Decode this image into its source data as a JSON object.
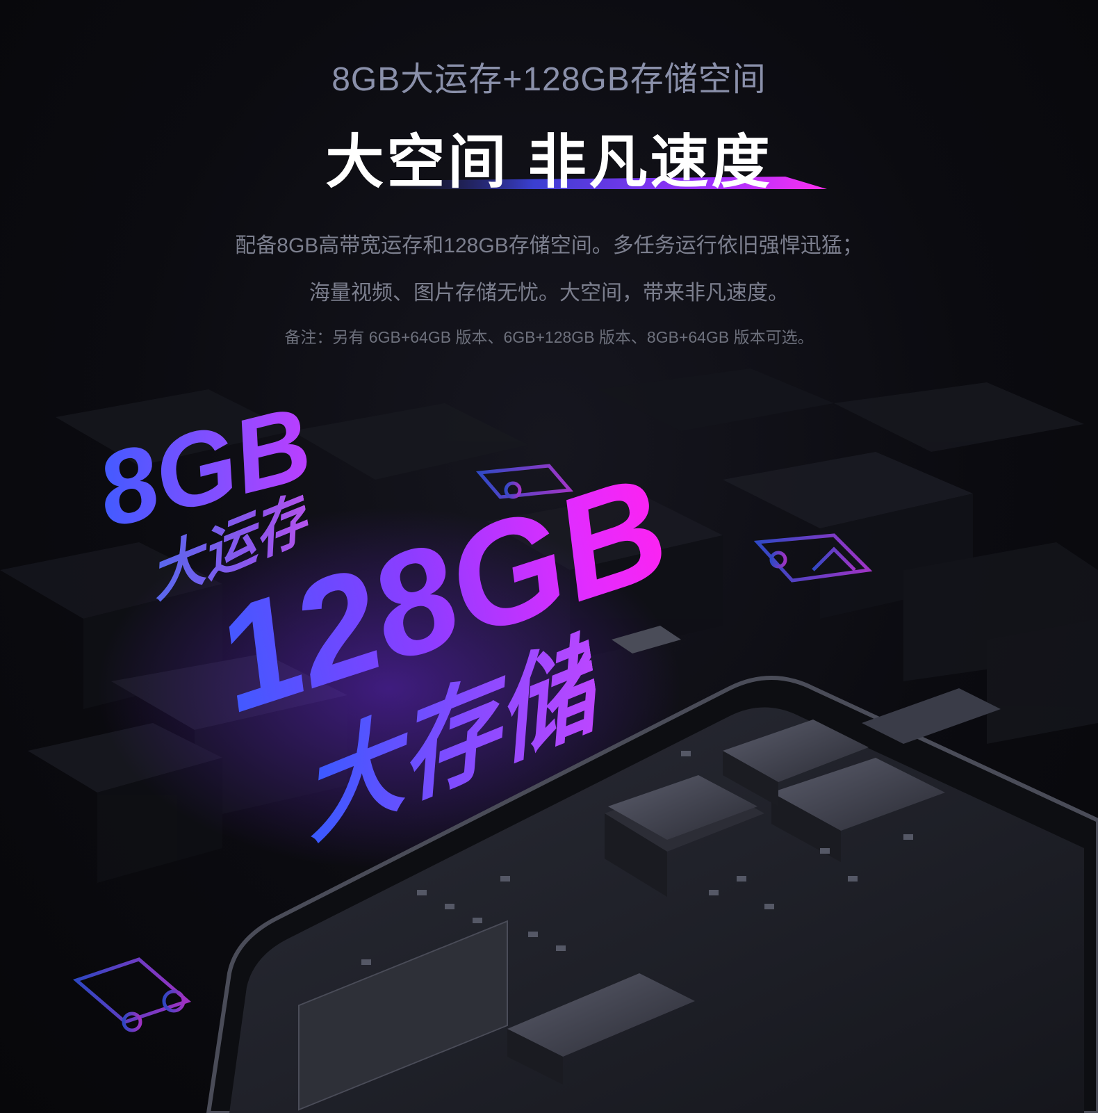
{
  "header": {
    "subtitle": "8GB大运存+128GB存储空间",
    "headline": "大空间 非凡速度"
  },
  "description": {
    "line1": "配备8GB高带宽运存和128GB存储空间。多任务运行依旧强悍迅猛；",
    "line2": "海量视频、图片存储无忧。大空间，带来非凡速度。",
    "note": "备注：另有 6GB+64GB 版本、6GB+128GB 版本、8GB+64GB 版本可选。"
  },
  "illustration": {
    "ram_value": "8GB",
    "ram_label": "大运存",
    "storage_value": "128GB",
    "storage_label": "大存储"
  },
  "colors": {
    "background": "#0b0b10",
    "accent_blue": "#3b5cff",
    "accent_magenta": "#ff22f0"
  }
}
